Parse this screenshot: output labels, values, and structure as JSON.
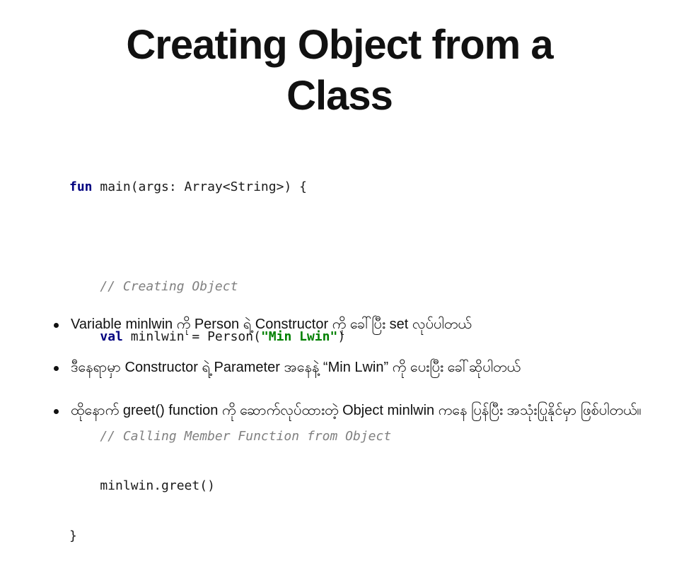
{
  "slide": {
    "title_line1": "Creating Object from a",
    "title_line2": "Class"
  },
  "code": {
    "l1_kw": "fun",
    "l1_rest": " main(args: Array<String>) {",
    "l3_comment": "    // Creating Object",
    "l4_indent": "    ",
    "l4_kw": "val",
    "l4_mid": " minlwin = Person(",
    "l4_str": "\"Min Lwin\"",
    "l4_end": ")",
    "l6_comment": "    // Calling Member Function from Object",
    "l7": "    minlwin.greet()",
    "l8": "}"
  },
  "bullets": [
    {
      "text": "Variable minlwin ကို Person ရဲ့ Constructor ကို ခေါ်ပြီး set လုပ်ပါတယ်"
    },
    {
      "text": "ဒီနေရာမှာ Constructor ရဲ့ Parameter အနေနဲ့ “Min Lwin” ကို ပေးပြီး ခေါ်ဆိုပါတယ်"
    },
    {
      "text": "ထိုနောက် greet() function ကို ဆောက်လုပ်ထားတဲ့ Object minlwin ကနေ ပြန်ပြီး အသုံးပြုနိုင်မှာ ဖြစ်ပါတယ်။"
    }
  ]
}
